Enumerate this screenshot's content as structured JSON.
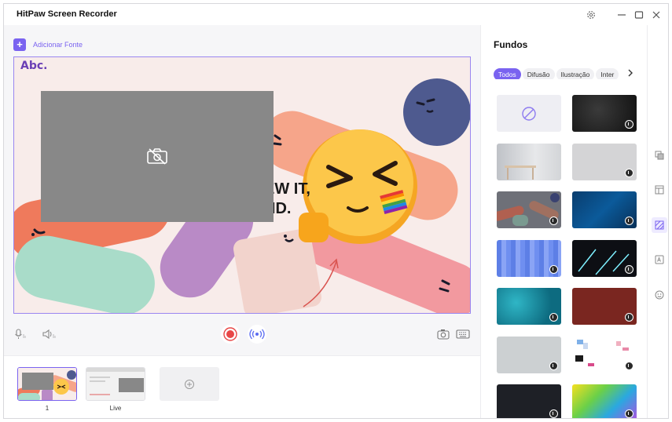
{
  "window": {
    "title": "HitPaw Screen Recorder"
  },
  "toolbar": {
    "add_source_label": "Adicionar Fonte"
  },
  "canvas": {
    "logo_text": "Abc.",
    "headline_line1": "EW IT,",
    "headline_line2": "ND."
  },
  "scenes": [
    {
      "label": "1",
      "active": true
    },
    {
      "label": "Live",
      "active": false
    }
  ],
  "panel": {
    "title": "Fundos",
    "tabs": [
      "Todos",
      "Difusão",
      "Ilustração",
      "Inter"
    ],
    "active_tab": "Todos"
  },
  "colors": {
    "accent": "#7a63f0",
    "record": "#e84747"
  },
  "icons": [
    "settings-icon",
    "minimize-icon",
    "maximize-icon",
    "close-icon",
    "camera-off-icon",
    "microphone-icon",
    "speaker-icon",
    "record-icon",
    "live-broadcast-icon",
    "screenshot-icon",
    "keyboard-icon",
    "add-scene-icon",
    "no-background-icon",
    "layers-icon",
    "layout-icon",
    "background-icon",
    "text-icon",
    "emoji-icon"
  ]
}
